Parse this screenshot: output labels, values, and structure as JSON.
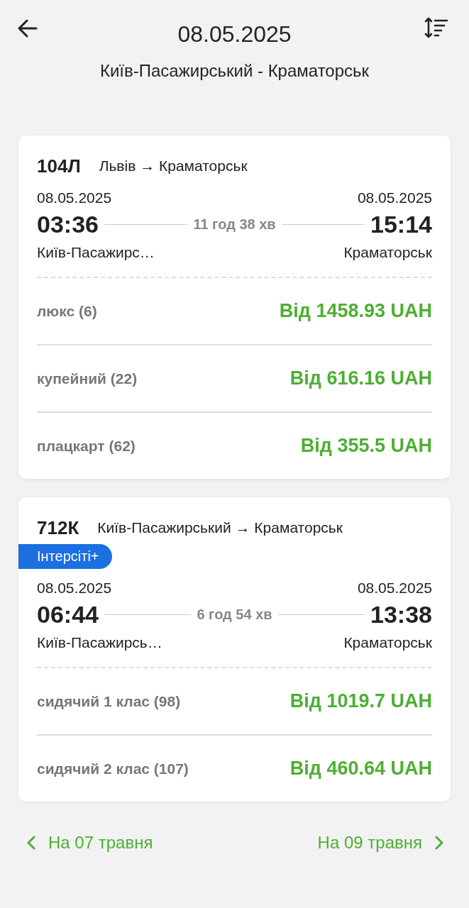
{
  "header": {
    "title": "08.05.2025",
    "subtitle": "Київ-Пасажирський - Краматорськ"
  },
  "trains": [
    {
      "number": "104Л",
      "route": "Львів → Краматорськ",
      "departure": {
        "date": "08.05.2025",
        "time": "03:36",
        "station": "Київ-Пасажирс…"
      },
      "duration": "11 год 38 хв",
      "arrival": {
        "date": "08.05.2025",
        "time": "15:14",
        "station": "Краматорськ"
      },
      "classes": [
        {
          "name": "люкс (6)",
          "price": "Від 1458.93 UAH"
        },
        {
          "name": "купейний (22)",
          "price": "Від 616.16 UAH"
        },
        {
          "name": "плацкарт (62)",
          "price": "Від 355.5 UAH"
        }
      ]
    },
    {
      "number": "712К",
      "route": "Київ-Пасажирський → Краматорськ",
      "badge": "Інтерсіті+",
      "departure": {
        "date": "08.05.2025",
        "time": "06:44",
        "station": "Київ-Пасажирсь…"
      },
      "duration": "6 год 54 хв",
      "arrival": {
        "date": "08.05.2025",
        "time": "13:38",
        "station": "Краматорськ"
      },
      "classes": [
        {
          "name": "сидячий 1 клас (98)",
          "price": "Від 1019.7 UAH"
        },
        {
          "name": "сидячий 2 клас (107)",
          "price": "Від 460.64 UAH"
        }
      ]
    }
  ],
  "footer": {
    "previous": "На 07 травня",
    "next": "На 09 травня"
  }
}
